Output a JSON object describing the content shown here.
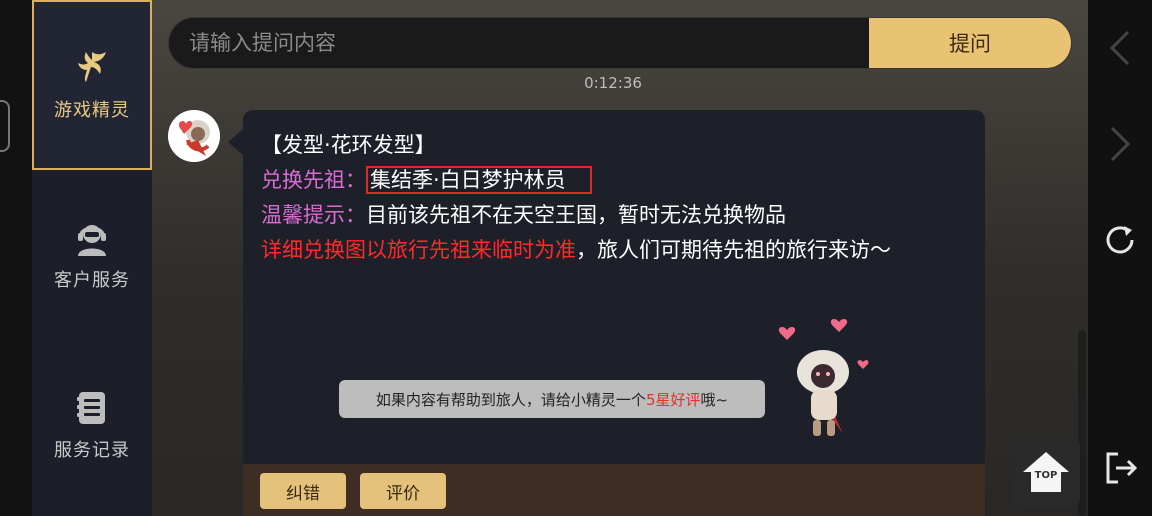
{
  "sidebar": {
    "items": [
      {
        "label": "游戏精灵",
        "icon": "fairy-icon",
        "active": true
      },
      {
        "label": "客户服务",
        "icon": "headset-agent-icon",
        "active": false
      },
      {
        "label": "服务记录",
        "icon": "records-icon",
        "active": false
      }
    ]
  },
  "search": {
    "placeholder": "请输入提问内容",
    "value": "",
    "submit_label": "提问"
  },
  "timestamp": "0:12:36",
  "message": {
    "title": "【发型·花环发型】",
    "exchange_label": "兑换先祖：",
    "exchange_value": "集结季·白日梦护林员",
    "tip_label": "温馨提示：",
    "tip_value": "目前该先祖不在天空王国，暂时无法兑换物品",
    "notice_red": "详细兑换图以旅行先祖来临时为准",
    "notice_rest": "，旅人们可期待先祖的旅行来访～",
    "rating_prompt_before": "如果内容有帮助到旅人，请给小精灵一个",
    "rating_prompt_highlight": "5星好评",
    "rating_prompt_after": "哦~"
  },
  "footer": {
    "correct_label": "纠错",
    "rate_label": "评价"
  },
  "scroll_top": {
    "label": "TOP"
  },
  "right_nav": {
    "icons": [
      "chevron-left-icon",
      "chevron-right-icon",
      "refresh-icon",
      "exit-icon"
    ]
  },
  "colors": {
    "accent_gold": "#e9c374",
    "label_pink": "#d96bd2",
    "notice_red": "#ff2a2a",
    "card_bg": "#1d2029",
    "sidebar_bg": "#1c1f2a"
  }
}
